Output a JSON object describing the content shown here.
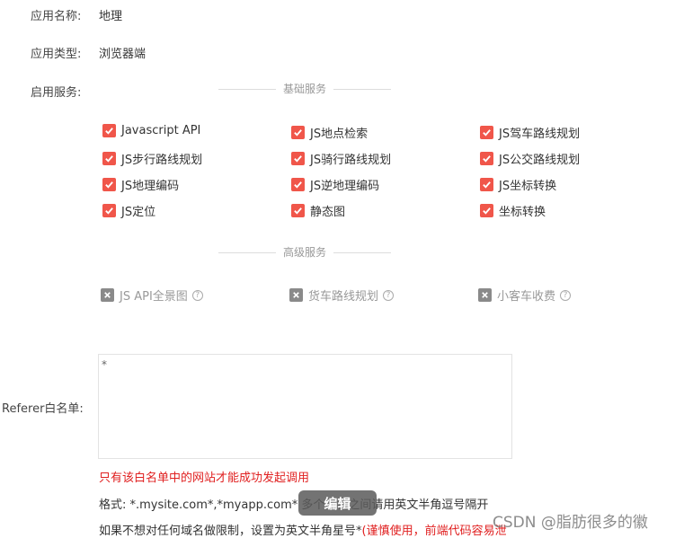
{
  "app_name": {
    "label": "应用名称:",
    "value": "地理"
  },
  "app_type": {
    "label": "应用类型:",
    "value": "浏览器端"
  },
  "services_label": "启用服务:",
  "basic_section": {
    "title": "基础服务",
    "items": [
      {
        "label": "Javascript API",
        "checked": true
      },
      {
        "label": "JS地点检索",
        "checked": true
      },
      {
        "label": "JS驾车路线规划",
        "checked": true
      },
      {
        "label": "JS步行路线规划",
        "checked": true
      },
      {
        "label": "JS骑行路线规划",
        "checked": true
      },
      {
        "label": "JS公交路线规划",
        "checked": true
      },
      {
        "label": "JS地理编码",
        "checked": true
      },
      {
        "label": "JS逆地理编码",
        "checked": true
      },
      {
        "label": "JS坐标转换",
        "checked": true
      },
      {
        "label": "JS定位",
        "checked": true
      },
      {
        "label": "静态图",
        "checked": true
      },
      {
        "label": "坐标转换",
        "checked": true
      }
    ]
  },
  "advanced_section": {
    "title": "高级服务",
    "items": [
      {
        "label": "JS API全景图",
        "checked": false,
        "help": "?"
      },
      {
        "label": "货车路线规划",
        "checked": false,
        "help": "?"
      },
      {
        "label": "小客车收费",
        "checked": false,
        "help": "?"
      }
    ]
  },
  "referer": {
    "label": "Referer白名单:",
    "value": "*"
  },
  "hints": {
    "only_whitelist": "只有该白名单中的网站才能成功发起调用",
    "format": "格式: *.mysite.com*,*myapp.com* 多个域名之间请用英文半角逗号隔开",
    "no_limit_prefix": "如果不想对任何域名做限制，设置为英文半角星号*",
    "no_limit_warning": "(谨慎使用，前端代码容易泄"
  },
  "overlay": {
    "edit_label": "编辑"
  },
  "watermark": "CSDN @脂肪很多的徽",
  "colors": {
    "checked": "#f0564a",
    "disabled": "#8a8a8a",
    "warning": "#e02020"
  }
}
